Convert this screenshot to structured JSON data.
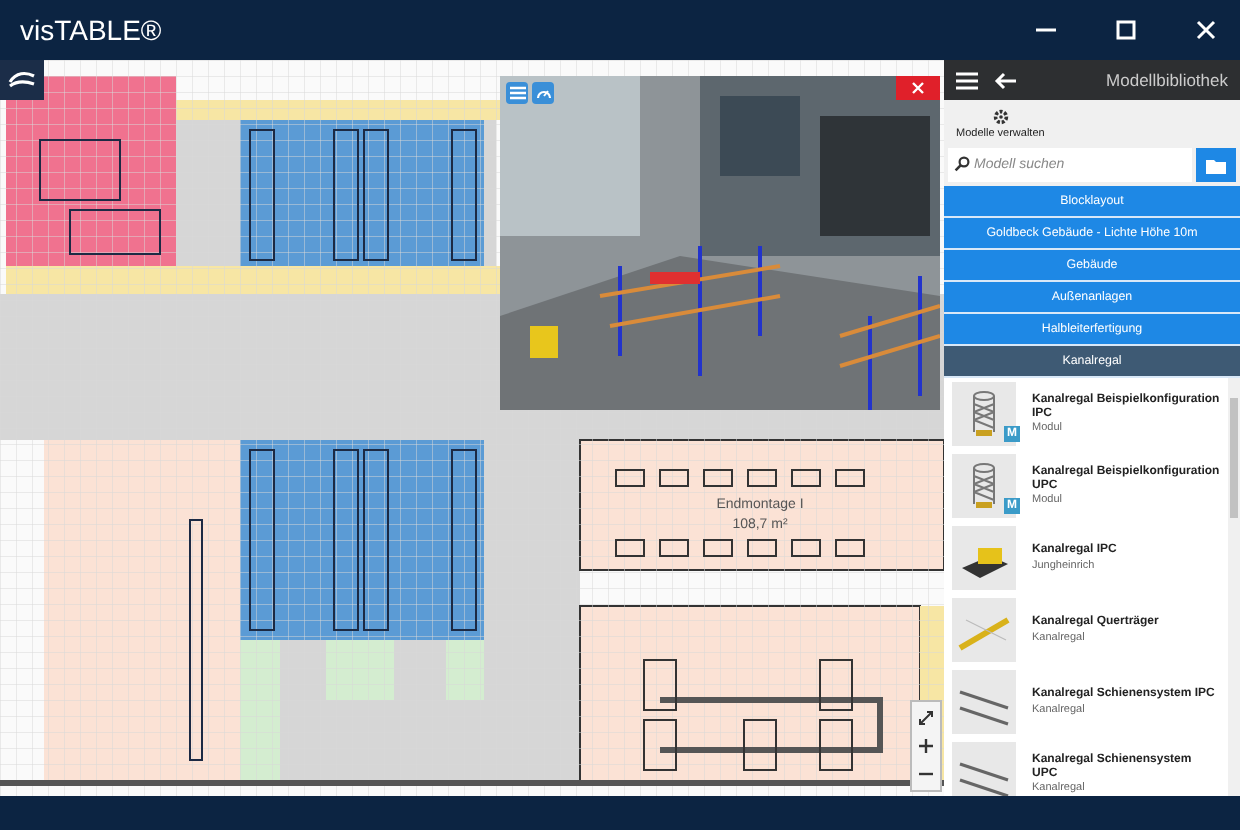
{
  "window": {
    "title": "visTABLE®"
  },
  "canvas": {
    "zone_labels": [
      "Endmontage I",
      "108,7 m²"
    ]
  },
  "library": {
    "title": "Modellbibliothek",
    "manage_label": "Modelle verwalten",
    "search": {
      "placeholder": "Modell suchen"
    },
    "categories": [
      {
        "label": "Blocklayout",
        "selected": false
      },
      {
        "label": "Goldbeck Gebäude - Lichte Höhe 10m",
        "selected": false
      },
      {
        "label": "Gebäude",
        "selected": false
      },
      {
        "label": "Außenanlagen",
        "selected": false
      },
      {
        "label": "Halbleiterfertigung",
        "selected": false
      },
      {
        "label": "Kanalregal",
        "selected": true
      }
    ],
    "items": [
      {
        "title": "Kanalregal Beispielkonfiguration IPC",
        "subtitle": "Modul",
        "badge": "M",
        "kind": "rack"
      },
      {
        "title": "Kanalregal Beispielkonfiguration UPC",
        "subtitle": "Modul",
        "badge": "M",
        "kind": "rack"
      },
      {
        "title": "Kanalregal IPC",
        "subtitle": "Jungheinrich",
        "kind": "vehicle"
      },
      {
        "title": "Kanalregal Querträger",
        "subtitle": "Kanalregal",
        "kind": "beam"
      },
      {
        "title": "Kanalregal Schienensystem IPC",
        "subtitle": "Kanalregal",
        "kind": "rail"
      },
      {
        "title": "Kanalregal Schienensystem UPC",
        "subtitle": "Kanalregal",
        "kind": "rail"
      }
    ]
  }
}
